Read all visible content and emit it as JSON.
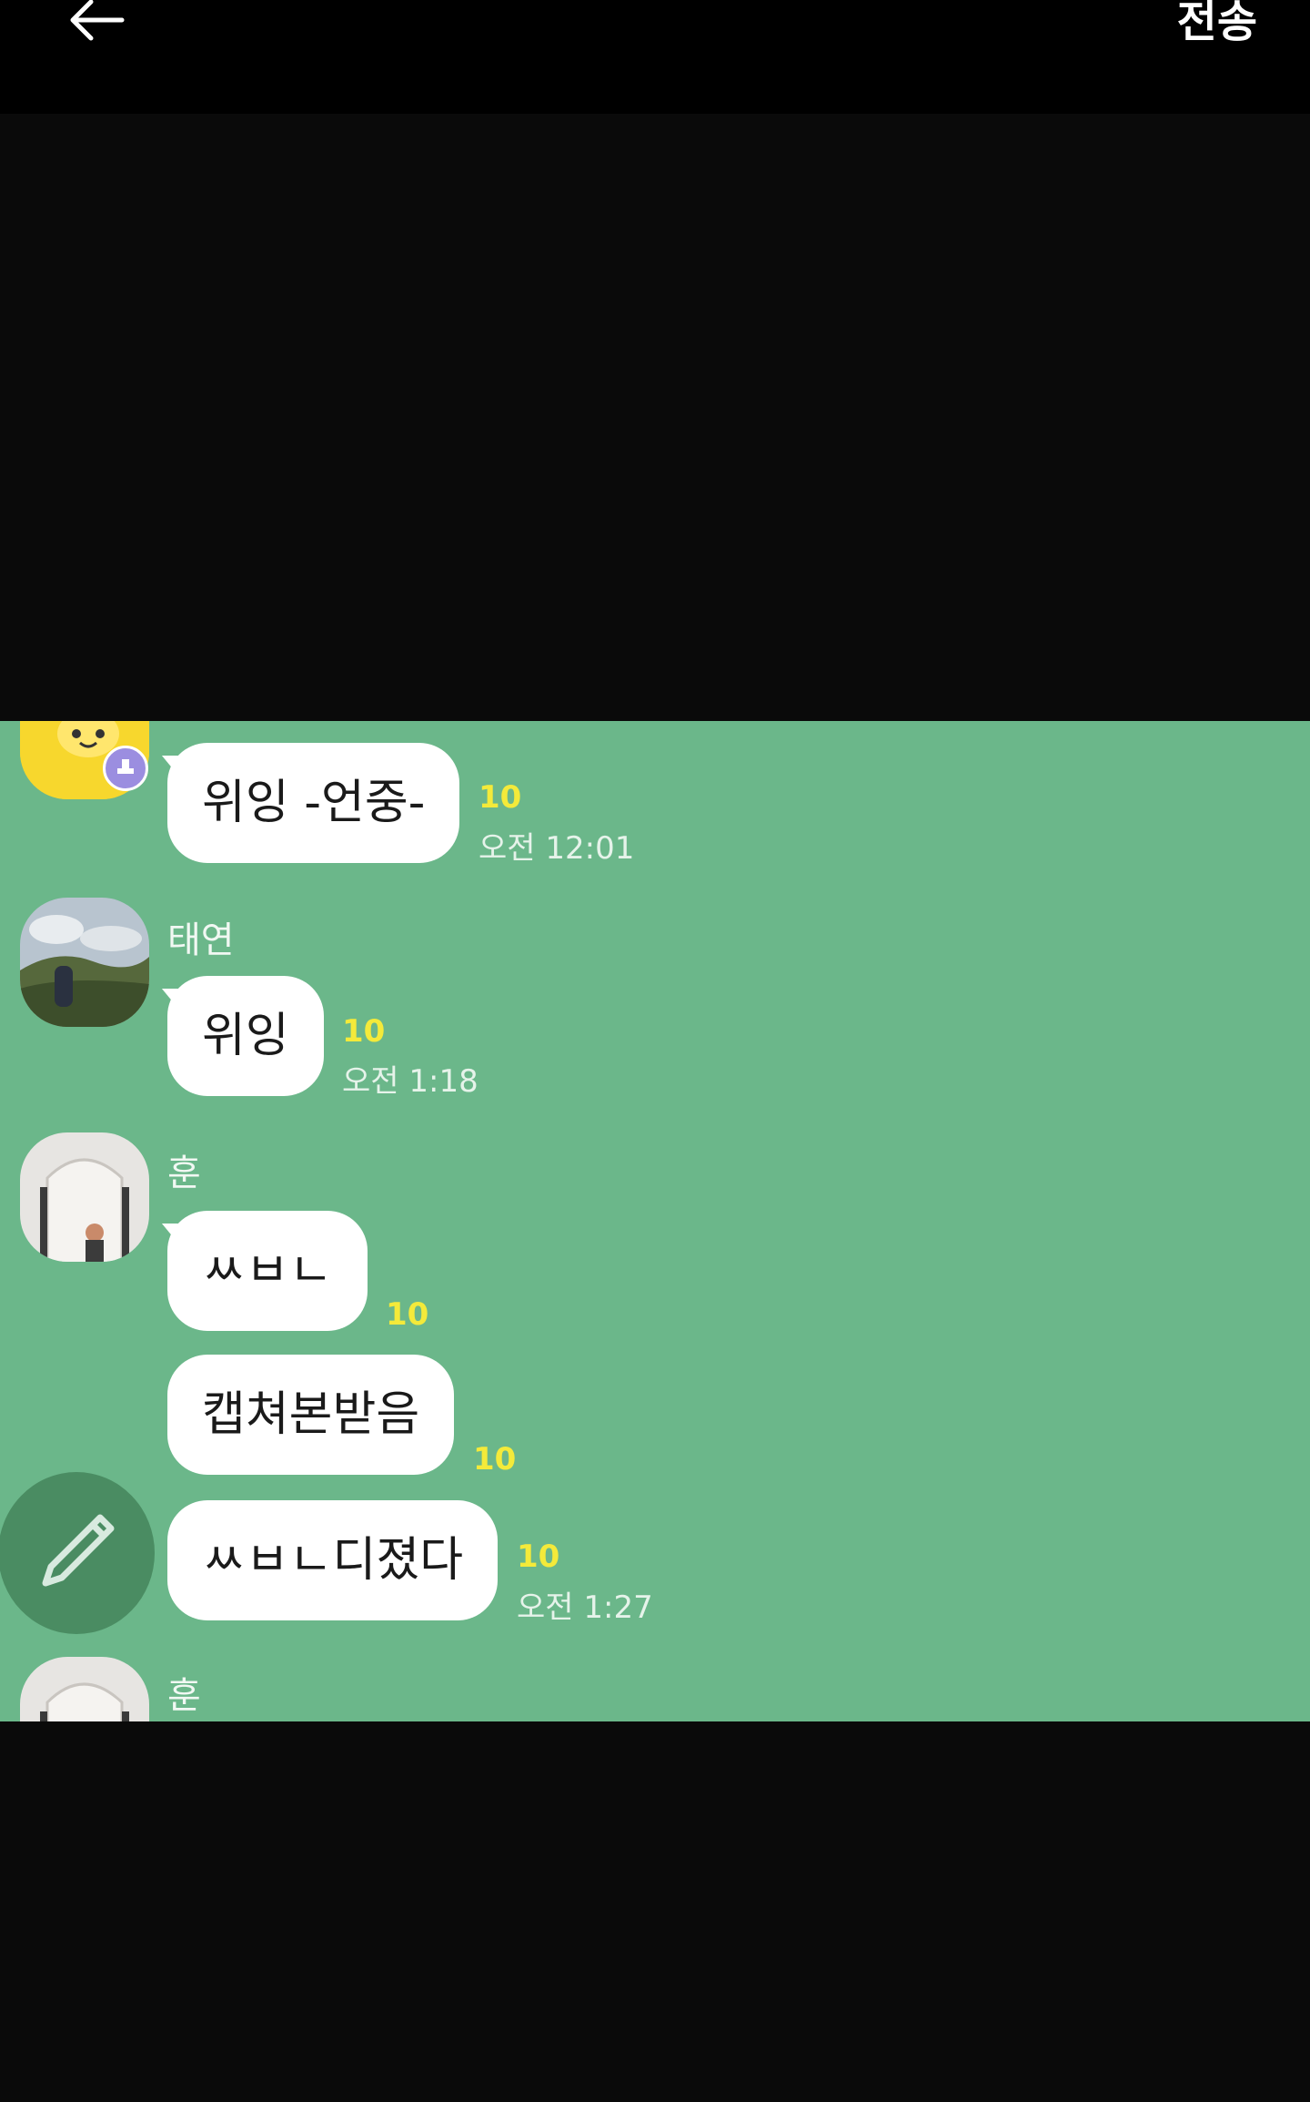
{
  "topbar": {
    "back_icon": "arrow-left-icon",
    "send_label": "전송"
  },
  "chat": {
    "messages": [
      {
        "text": "위잉 -언중-",
        "unread": "10",
        "time": "오전 12:01"
      },
      {
        "name": "태연",
        "text": "위잉",
        "unread": "10",
        "time": "오전 1:18"
      },
      {
        "name": "훈",
        "text": "ㅆㅂㄴ",
        "unread": "10"
      },
      {
        "text": "캡쳐본받음",
        "unread": "10"
      },
      {
        "text": "ㅆㅂㄴ디졌다",
        "unread": "10",
        "time": "오전 1:27"
      },
      {
        "name": "훈"
      }
    ],
    "background_color": "#6bb78a",
    "unread_color": "#f4ea3a"
  },
  "compose": {
    "icon": "pencil-icon"
  }
}
